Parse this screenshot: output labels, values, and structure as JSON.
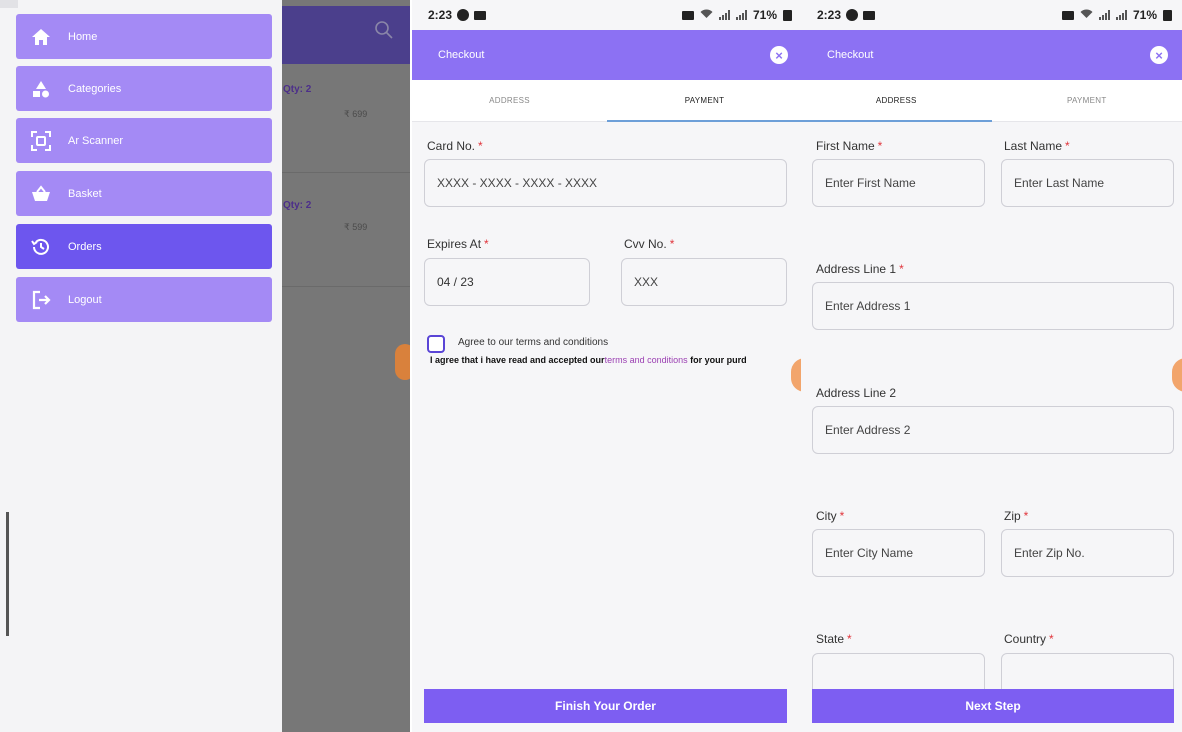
{
  "drawer": {
    "items": [
      {
        "label": "Home",
        "icon": "home-icon",
        "active": false
      },
      {
        "label": "Categories",
        "icon": "categories-icon",
        "active": false
      },
      {
        "label": "Ar Scanner",
        "icon": "scanner-icon",
        "active": false
      },
      {
        "label": "Basket",
        "icon": "basket-icon",
        "active": false
      },
      {
        "label": "Orders",
        "icon": "orders-history-icon",
        "active": true
      },
      {
        "label": "Logout",
        "icon": "logout-icon",
        "active": false
      }
    ],
    "background_items": [
      {
        "qty": "Qty: 2",
        "price": "₹ 699"
      },
      {
        "qty": "Qty: 2",
        "price": "₹ 599"
      }
    ]
  },
  "status_bar": {
    "time": "2:23",
    "battery": "71%"
  },
  "payment_screen": {
    "title": "Checkout",
    "tabs": [
      "ADDRESS",
      "PAYMENT"
    ],
    "active_tab": "PAYMENT",
    "card_label": "Card No.",
    "card_placeholder": "XXXX - XXXX - XXXX - XXXX",
    "expires_label": "Expires At",
    "expires_value": "04 / 23",
    "cvv_label": "Cvv No.",
    "cvv_placeholder": "XXX",
    "agree_title": "Agree to our terms and conditions",
    "agree_text_before": "I agree that i have read and accepted our",
    "agree_link": "terms and conditions",
    "agree_text_after": " for your purd",
    "button": "Finish Your Order"
  },
  "address_screen": {
    "title": "Checkout",
    "tabs": [
      "ADDRESS",
      "PAYMENT"
    ],
    "active_tab": "ADDRESS",
    "first_name_label": "First Name",
    "first_name_placeholder": "Enter First Name",
    "last_name_label": "Last Name",
    "last_name_placeholder": "Enter Last Name",
    "address1_label": "Address Line 1",
    "address1_placeholder": "Enter Address 1",
    "address2_label": "Address Line 2",
    "address2_placeholder": "Enter Address 2",
    "city_label": "City",
    "city_placeholder": "Enter City Name",
    "zip_label": "Zip",
    "zip_placeholder": "Enter Zip No.",
    "state_label": "State",
    "country_label": "Country",
    "button": "Next Step"
  },
  "colors": {
    "primary": "#8c71f3",
    "active_nav": "#6d56ee",
    "nav": "#a48af5",
    "required": "#e0343b"
  }
}
